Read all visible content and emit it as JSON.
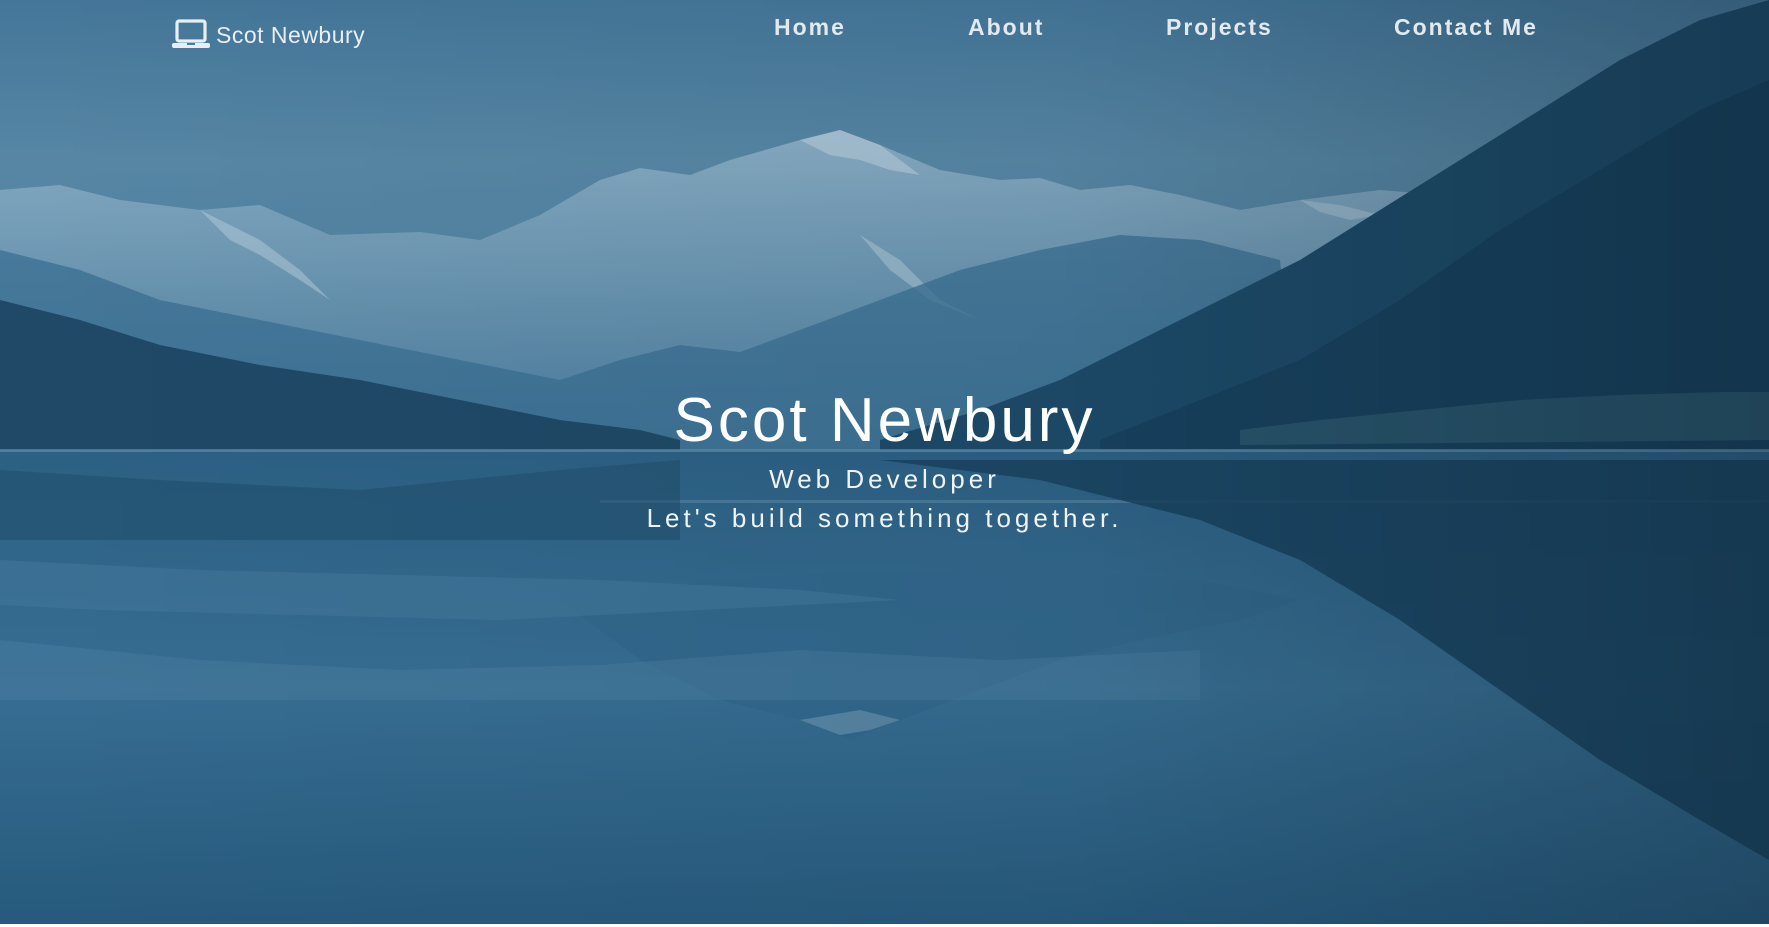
{
  "nav": {
    "brand_text": "Scot Newbury",
    "brand_icon": "laptop-icon",
    "links": [
      {
        "label": "Home"
      },
      {
        "label": "About"
      },
      {
        "label": "Projects"
      },
      {
        "label": "Contact Me"
      }
    ]
  },
  "hero": {
    "title": "Scot Newbury",
    "subtitle": "Web Developer",
    "tagline": "Let's build something together.",
    "background": "mountain-lake-reflection",
    "overlay_color": "#1f5a82"
  }
}
